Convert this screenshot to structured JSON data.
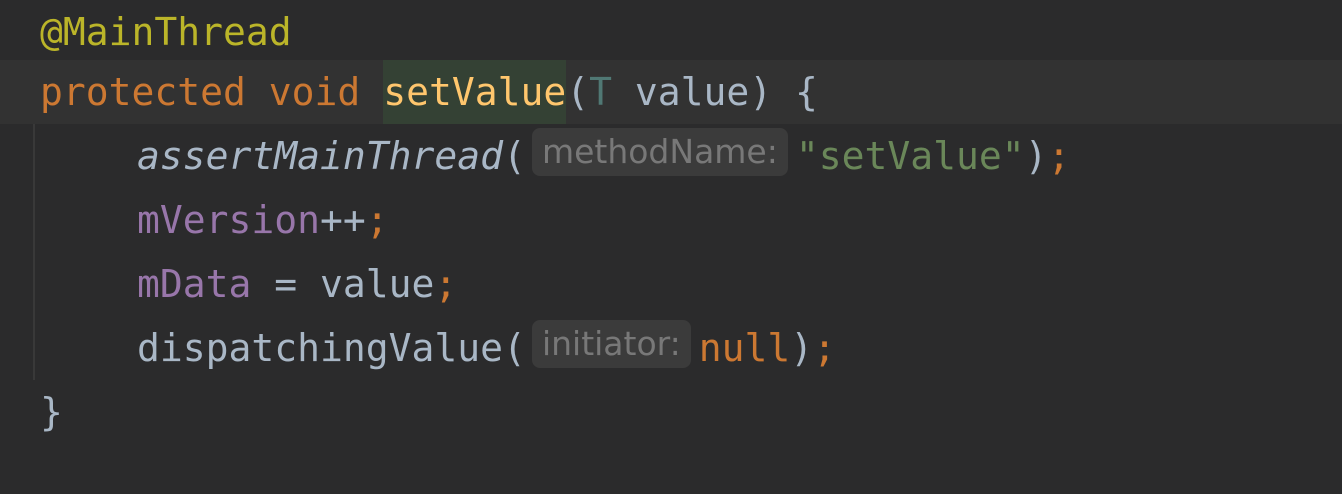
{
  "editor": {
    "lines": [
      {
        "annotation": "@MainThread"
      },
      {
        "keyword_protected": "protected",
        "keyword_void": "void",
        "method_name": "setValue",
        "paren_open": "(",
        "type_param": "T",
        "param_name": " value",
        "paren_close_brace": ") {"
      },
      {
        "call": "assertMainThread",
        "paren_open": "(",
        "hint": "methodName:",
        "string_arg": "\"setValue\"",
        "paren_close": ")",
        "semicolon": ";"
      },
      {
        "field": "mVersion",
        "op": "++",
        "semicolon": ";"
      },
      {
        "field": "mData",
        "op": " = value",
        "semicolon": ";"
      },
      {
        "call": "dispatchingValue",
        "paren_open": "(",
        "hint": "initiator:",
        "null_arg": "null",
        "paren_close": ")",
        "semicolon": ";"
      },
      {
        "brace": "}"
      }
    ]
  },
  "colors": {
    "background": "#2b2b2c",
    "current_line": "#323232",
    "annotation": "#bbb529",
    "keyword": "#cc7832",
    "method_declaration": "#ffc66d",
    "field": "#9876aa",
    "string": "#6a8759",
    "default_text": "#a9b7c6",
    "inlay_hint": "#787878"
  }
}
